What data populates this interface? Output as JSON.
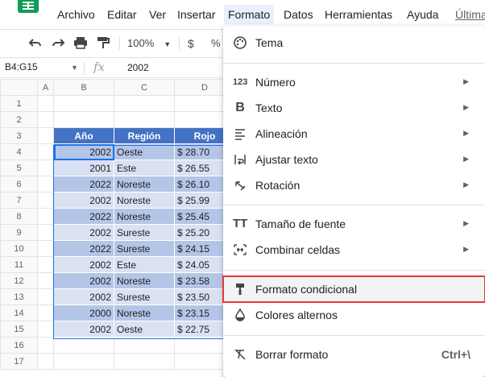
{
  "menubar": {
    "items": [
      "Archivo",
      "Editar",
      "Ver",
      "Insertar",
      "Formato",
      "Datos",
      "Herramientas",
      "Ayuda",
      "Última"
    ]
  },
  "toolbar": {
    "zoom": "100%",
    "currency": "$",
    "percent": "%"
  },
  "formula_bar": {
    "namebox": "B4:G15",
    "fx": "fx",
    "value": "2002"
  },
  "sheet": {
    "col_headers": [
      "A",
      "B",
      "C",
      "D"
    ],
    "row_numbers": [
      "1",
      "2",
      "3",
      "4",
      "5",
      "6",
      "7",
      "8",
      "9",
      "10",
      "11",
      "12",
      "13",
      "14",
      "15",
      "16",
      "17"
    ],
    "table_headers": [
      "Año",
      "Región",
      "Rojo"
    ],
    "rows": [
      [
        "2002",
        "Oeste",
        "$ 28.70"
      ],
      [
        "2001",
        "Este",
        "$ 26.55"
      ],
      [
        "2022",
        "Noreste",
        "$ 26.10"
      ],
      [
        "2002",
        "Noreste",
        "$ 25.99"
      ],
      [
        "2022",
        "Noreste",
        "$ 25.45"
      ],
      [
        "2002",
        "Sureste",
        "$ 25.20"
      ],
      [
        "2022",
        "Sureste",
        "$ 24.15"
      ],
      [
        "2002",
        "Este",
        "$ 24.05"
      ],
      [
        "2002",
        "Noreste",
        "$ 23.58"
      ],
      [
        "2002",
        "Sureste",
        "$ 23.50"
      ],
      [
        "2000",
        "Noreste",
        "$ 23.15"
      ],
      [
        "2002",
        "Oeste",
        "$ 22.75"
      ]
    ]
  },
  "format_menu": {
    "tema": "Tema",
    "numero": "Número",
    "texto": "Texto",
    "alineacion": "Alineación",
    "ajustar": "Ajustar texto",
    "rotacion": "Rotación",
    "tamano": "Tamaño de fuente",
    "combinar": "Combinar celdas",
    "condicional": "Formato condicional",
    "alternos": "Colores alternos",
    "borrar": "Borrar formato",
    "borrar_shortcut": "Ctrl+\\"
  },
  "colors": {
    "header_fill": "#4472c4",
    "band_dark": "#b4c6e7",
    "band_light": "#d9e1f2",
    "highlight_box": "#e53935",
    "selection": "#1a73e8"
  }
}
